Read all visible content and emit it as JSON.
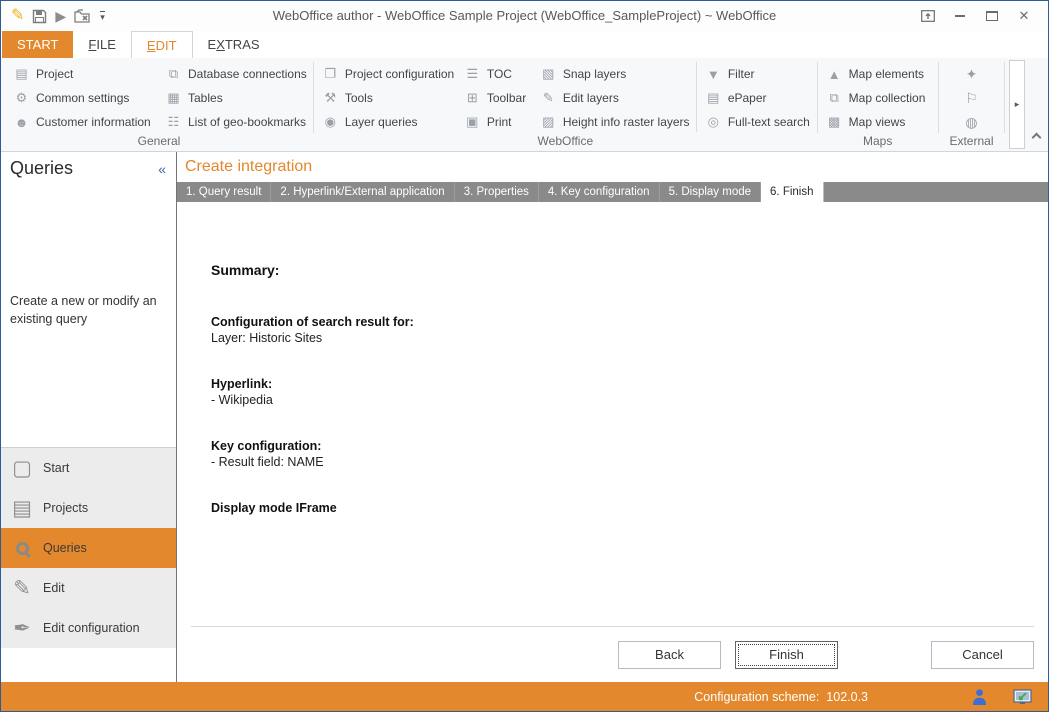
{
  "colors": {
    "accent_orange": "#E3882C",
    "window_border_blue": "#2F5C97",
    "wizard_tab_gray": "#8A8A8A",
    "nav_item_bg": "#ECECEC",
    "status_user_blue": "#3A6FD8"
  },
  "title_bar": {
    "title": "WebOffice author - WebOffice Sample Project (WebOffice_SampleProject) ~ WebOffice"
  },
  "ribbon_tabs": {
    "start": {
      "label": "START"
    },
    "file": {
      "pre": "",
      "key": "F",
      "post": "ILE"
    },
    "edit": {
      "pre": "",
      "key": "E",
      "post": "DIT"
    },
    "extras": {
      "pre": "E",
      "key": "X",
      "post": "TRAS"
    }
  },
  "ribbon": {
    "more_arrow": "▸",
    "groups": [
      {
        "label": "General",
        "columns": [
          {
            "items": [
              {
                "icon": "project-icon",
                "glyph": "▤",
                "label": "Project"
              },
              {
                "icon": "gears-icon",
                "glyph": "⚙",
                "label": "Common settings"
              },
              {
                "icon": "customer-information-icon",
                "glyph": "☻",
                "label": "Customer information"
              }
            ]
          },
          {
            "items": [
              {
                "icon": "database-connections-icon",
                "glyph": "⧉",
                "label": "Database connections"
              },
              {
                "icon": "tables-icon",
                "glyph": "▦",
                "label": "Tables"
              },
              {
                "icon": "geo-bookmarks-icon",
                "glyph": "☷",
                "label": "List of geo-bookmarks"
              }
            ]
          }
        ]
      },
      {
        "label": "WebOffice",
        "columns": [
          {
            "items": [
              {
                "icon": "project-configuration-icon",
                "glyph": "❐",
                "label": "Project configuration"
              },
              {
                "icon": "tools-icon",
                "glyph": "⚒",
                "label": "Tools"
              },
              {
                "icon": "layer-queries-icon",
                "glyph": "◉",
                "label": "Layer queries"
              }
            ]
          },
          {
            "items": [
              {
                "icon": "toc-icon",
                "glyph": "☰",
                "label": "TOC"
              },
              {
                "icon": "toolbar-icon",
                "glyph": "⊞",
                "label": "Toolbar"
              },
              {
                "icon": "print-icon",
                "glyph": "▣",
                "label": "Print"
              }
            ]
          },
          {
            "items": [
              {
                "icon": "snap-layers-icon",
                "glyph": "▧",
                "label": "Snap layers"
              },
              {
                "icon": "edit-layers-icon",
                "glyph": "✎",
                "label": "Edit layers"
              },
              {
                "icon": "height-info-raster-layers-icon",
                "glyph": "▨",
                "label": "Height info raster layers"
              }
            ]
          },
          {
            "items": [
              {
                "icon": "filter-icon",
                "glyph": "▼",
                "label": "Filter"
              },
              {
                "icon": "epaper-icon",
                "glyph": "▤",
                "label": "ePaper"
              },
              {
                "icon": "full-text-search-icon",
                "glyph": "◎",
                "label": "Full-text search"
              }
            ]
          }
        ]
      },
      {
        "label": "Maps",
        "columns": [
          {
            "items": [
              {
                "icon": "map-elements-icon",
                "glyph": "▲",
                "label": "Map elements"
              },
              {
                "icon": "map-collection-icon",
                "glyph": "⧉",
                "label": "Map collection"
              },
              {
                "icon": "map-views-icon",
                "glyph": "▩",
                "label": "Map views"
              }
            ]
          }
        ]
      },
      {
        "label": "External",
        "columns": [
          {
            "items": [
              {
                "icon": "pin-icon",
                "glyph": "✦",
                "label": ""
              },
              {
                "icon": "map-marker-icon",
                "glyph": "⚐",
                "label": ""
              },
              {
                "icon": "database-search-icon",
                "glyph": "◍",
                "label": ""
              }
            ]
          }
        ]
      }
    ]
  },
  "sidebar": {
    "title": "Queries",
    "collapse_glyph": "«",
    "description": "Create a new or modify an existing query",
    "nav": [
      {
        "icon": "start-icon",
        "glyph": "▢",
        "label": "Start",
        "selected": false
      },
      {
        "icon": "projects-icon",
        "glyph": "▤",
        "label": "Projects",
        "selected": false
      },
      {
        "icon": "magnifier-icon",
        "glyph": "",
        "label": "Queries",
        "selected": true
      },
      {
        "icon": "edit-icon",
        "glyph": "✎",
        "label": "Edit",
        "selected": false
      },
      {
        "icon": "edit-configuration-icon",
        "glyph": "✒",
        "label": "Edit configuration",
        "selected": false
      }
    ]
  },
  "content": {
    "heading": "Create integration",
    "wizard_tabs": [
      {
        "label": "1. Query result",
        "active": false
      },
      {
        "label": "2. Hyperlink/External application",
        "active": false
      },
      {
        "label": "3. Properties",
        "active": false
      },
      {
        "label": "4. Key configuration",
        "active": false
      },
      {
        "label": "5. Display mode",
        "active": false
      },
      {
        "label": "6. Finish",
        "active": true
      }
    ],
    "summary": {
      "title": "Summary:",
      "sections": [
        {
          "heading": "Configuration of search result for:",
          "line": "Layer: Historic Sites"
        },
        {
          "heading": "Hyperlink:",
          "line": "- Wikipedia"
        },
        {
          "heading": "Key configuration:",
          "line": "- Result field: NAME"
        },
        {
          "heading": "Display mode IFrame",
          "line": ""
        }
      ]
    },
    "buttons": {
      "back": "Back",
      "finish": "Finish",
      "cancel": "Cancel"
    }
  },
  "status_bar": {
    "text": "Configuration scheme:  102.0.3"
  }
}
